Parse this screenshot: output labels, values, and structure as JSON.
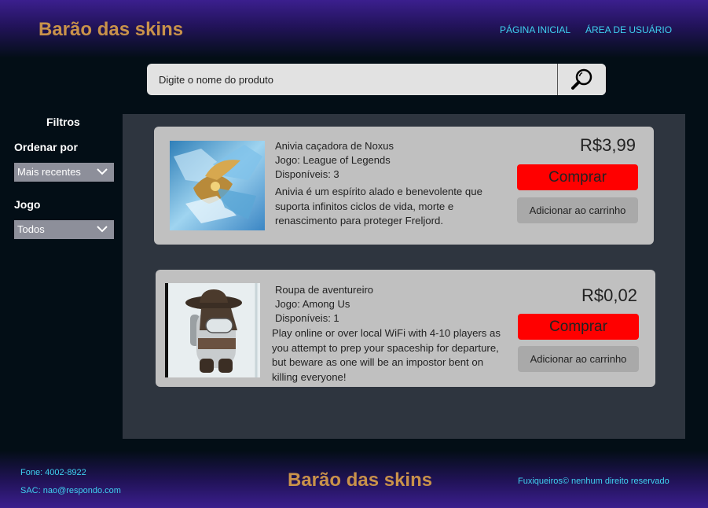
{
  "header": {
    "brand": "Barão das skins",
    "nav": {
      "home": "PÁGINA INICIAL",
      "user_area": "ÁREA DE USUÁRIO"
    }
  },
  "search": {
    "placeholder": "Digite o nome do produto",
    "icon": "search-icon"
  },
  "filters": {
    "title": "Filtros",
    "sort_label": "Ordenar por",
    "sort_value": "Mais recentes",
    "game_label": "Jogo",
    "game_value": "Todos"
  },
  "products": [
    {
      "name": "Anivia caçadora de Noxus",
      "game": "Jogo: League of Legends",
      "available": "Disponíveis: 3",
      "description": "Anivia é um espírito alado e benevolente que suporta infinitos ciclos de vida, morte e renascimento para proteger Freljord.",
      "price": "R$3,99",
      "buy_label": "Comprar",
      "cart_label": "Adicionar ao carrinho"
    },
    {
      "name": "Roupa de aventureiro",
      "game": "Jogo: Among Us",
      "available": "Disponíveis: 1",
      "description": "Play online or over local WiFi with 4-10 players as you attempt to prep your spaceship for departure, but beware as one will be an impostor bent on killing everyone!",
      "price": "R$0,02",
      "buy_label": "Comprar",
      "cart_label": "Adicionar ao carrinho"
    }
  ],
  "footer": {
    "phone": "Fone: 4002-8922",
    "sac": "SAC: nao@respondo.com",
    "brand": "Barão das skins",
    "rights": "Fuxiqueiros© nenhum direito reservado"
  },
  "colors": {
    "brand": "#c9924a",
    "link": "#3fd2f0",
    "buy": "#ff0000",
    "card": "#c0c0c0"
  }
}
